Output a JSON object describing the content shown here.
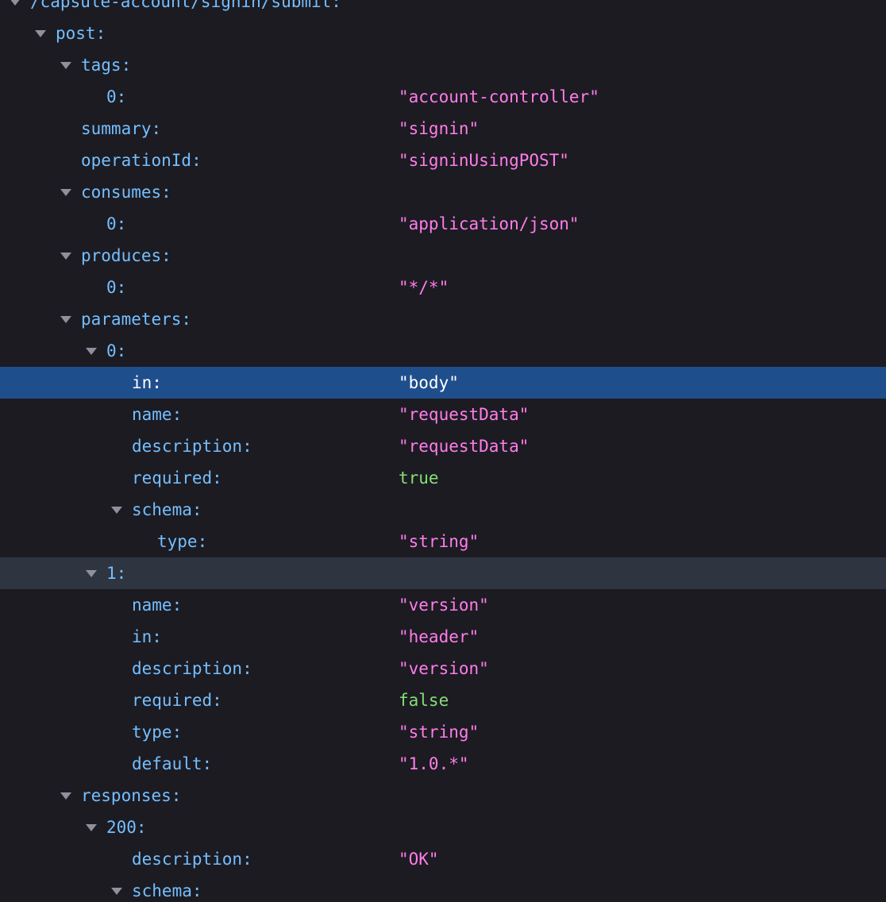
{
  "colors": {
    "background": "#1c1b22",
    "key": "#75bfff",
    "string": "#ff7de9",
    "boolean": "#86de74",
    "selected_row": "#1f4e8c",
    "hovered_row": "#2e3440",
    "twisty": "#8f8f9d"
  },
  "icons": {
    "expanded": "chevron-down-icon"
  },
  "rows": [
    {
      "key": "/capsule-account/signin/submit:",
      "value": "",
      "type": "object",
      "expanded": true,
      "depth": 0
    },
    {
      "key": "post:",
      "value": "",
      "type": "object",
      "expanded": true,
      "depth": 1
    },
    {
      "key": "tags:",
      "value": "",
      "type": "object",
      "expanded": true,
      "depth": 2
    },
    {
      "key": "0:",
      "value": "\"account-controller\"",
      "type": "string",
      "depth": 3
    },
    {
      "key": "summary:",
      "value": "\"signin\"",
      "type": "string",
      "depth": 2
    },
    {
      "key": "operationId:",
      "value": "\"signinUsingPOST\"",
      "type": "string",
      "depth": 2
    },
    {
      "key": "consumes:",
      "value": "",
      "type": "object",
      "expanded": true,
      "depth": 2
    },
    {
      "key": "0:",
      "value": "\"application/json\"",
      "type": "string",
      "depth": 3
    },
    {
      "key": "produces:",
      "value": "",
      "type": "object",
      "expanded": true,
      "depth": 2
    },
    {
      "key": "0:",
      "value": "\"*/*\"",
      "type": "string",
      "depth": 3
    },
    {
      "key": "parameters:",
      "value": "",
      "type": "object",
      "expanded": true,
      "depth": 2
    },
    {
      "key": "0:",
      "value": "",
      "type": "object",
      "expanded": true,
      "depth": 3
    },
    {
      "key": "in:",
      "value": "\"body\"",
      "type": "string",
      "depth": 4,
      "selected": true
    },
    {
      "key": "name:",
      "value": "\"requestData\"",
      "type": "string",
      "depth": 4
    },
    {
      "key": "description:",
      "value": "\"requestData\"",
      "type": "string",
      "depth": 4
    },
    {
      "key": "required:",
      "value": "true",
      "type": "bool",
      "depth": 4
    },
    {
      "key": "schema:",
      "value": "",
      "type": "object",
      "expanded": true,
      "depth": 4
    },
    {
      "key": "type:",
      "value": "\"string\"",
      "type": "string",
      "depth": 5
    },
    {
      "key": "1:",
      "value": "",
      "type": "object",
      "expanded": true,
      "depth": 3,
      "hovered": true
    },
    {
      "key": "name:",
      "value": "\"version\"",
      "type": "string",
      "depth": 4
    },
    {
      "key": "in:",
      "value": "\"header\"",
      "type": "string",
      "depth": 4
    },
    {
      "key": "description:",
      "value": "\"version\"",
      "type": "string",
      "depth": 4
    },
    {
      "key": "required:",
      "value": "false",
      "type": "bool",
      "depth": 4
    },
    {
      "key": "type:",
      "value": "\"string\"",
      "type": "string",
      "depth": 4
    },
    {
      "key": "default:",
      "value": "\"1.0.*\"",
      "type": "string",
      "depth": 4
    },
    {
      "key": "responses:",
      "value": "",
      "type": "object",
      "expanded": true,
      "depth": 2
    },
    {
      "key": "200:",
      "value": "",
      "type": "object",
      "expanded": true,
      "depth": 3
    },
    {
      "key": "description:",
      "value": "\"OK\"",
      "type": "string",
      "depth": 4
    },
    {
      "key": "schema:",
      "value": "",
      "type": "object",
      "expanded": true,
      "depth": 4
    }
  ]
}
